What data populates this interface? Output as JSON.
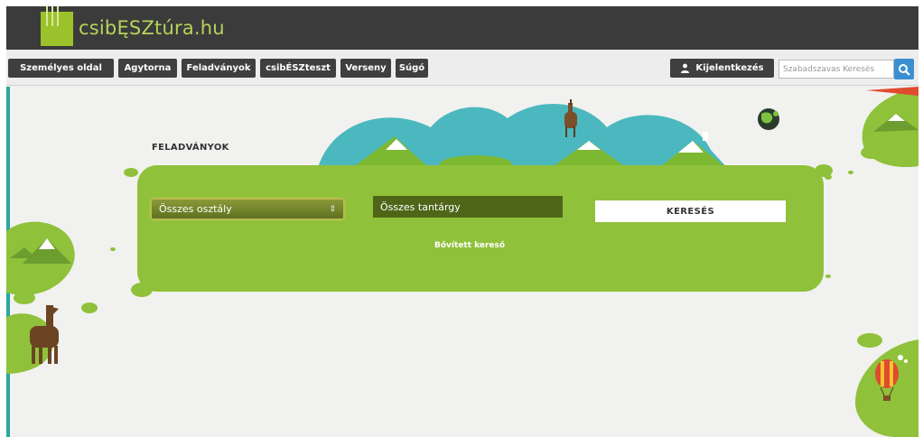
{
  "header": {
    "logo_text": "csibĘSZtúra.hu"
  },
  "navbar": {
    "items": [
      {
        "label": "Személyes oldal"
      },
      {
        "label": "Agytorna"
      },
      {
        "label": "Feladványok"
      },
      {
        "label": "csibÉSZteszt"
      },
      {
        "label": "Verseny"
      },
      {
        "label": "Súgó"
      }
    ],
    "logout_label": "Kijelentkezés",
    "search_placeholder": "Szabadszavas Keresés"
  },
  "main": {
    "section_title": "FELADVÁNYOK",
    "class_select_value": "Összes osztály",
    "subject_select_value": "Összes tantárgy",
    "search_button_label": "KERESÉS",
    "advanced_search_label": "Bővített kereső"
  },
  "colors": {
    "header_bg": "#3b3b3b",
    "accent_green": "#8fc13a",
    "dark_green": "#4f6619",
    "teal": "#2aa6a2",
    "search_blue": "#3a8fd0"
  },
  "icons": {
    "user": "user-icon",
    "search": "magnifier-icon",
    "globe": "globe-icon",
    "balloon": "hot-air-balloon-icon",
    "alpaca": "alpaca-icon"
  }
}
